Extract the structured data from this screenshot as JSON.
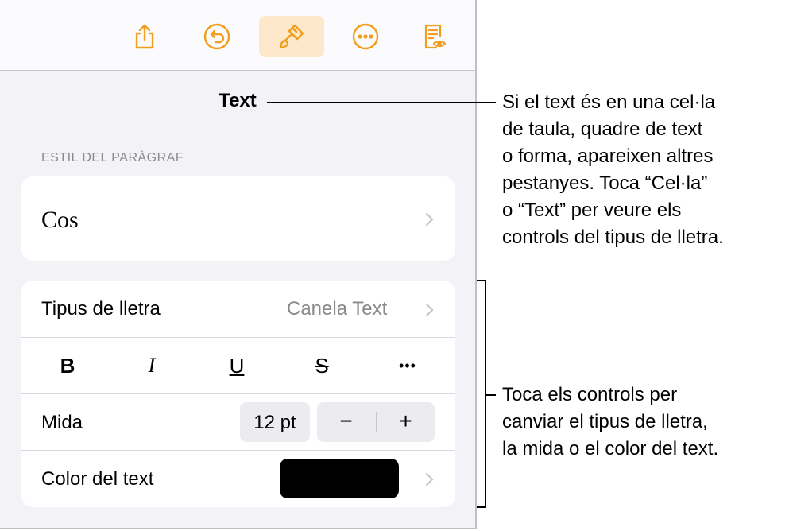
{
  "panel": {
    "title": "Text",
    "paragraph_style_header": "ESTIL DEL PARÀGRAF",
    "paragraph_style_value": "Cos",
    "font_label": "Tipus de lletra",
    "font_value": "Canela Text",
    "format_buttons": {
      "bold": "B",
      "italic": "I",
      "underline": "U",
      "strike": "S",
      "more": "•••"
    },
    "size_label": "Mida",
    "size_value": "12 pt",
    "decrease_label": "−",
    "increase_label": "+",
    "color_label": "Color del text",
    "color_value": "#000000"
  },
  "toolbar": {
    "icons": [
      "share-icon",
      "undo-icon",
      "paintbrush-icon",
      "more-icon",
      "reading-view-icon"
    ],
    "accent": "#f29d1c",
    "active": "paintbrush-icon"
  },
  "callouts": {
    "top": [
      "Si el text és en una cel·la",
      "de taula, quadre de text",
      "o forma, apareixen altres",
      "pestanyes. Toca “Cel·la”",
      "o “Text” per veure els",
      "controls del tipus de lletra."
    ],
    "bottom": [
      "Toca els controls per",
      "canviar el tipus de lletra,",
      "la mida o el color del text."
    ]
  }
}
